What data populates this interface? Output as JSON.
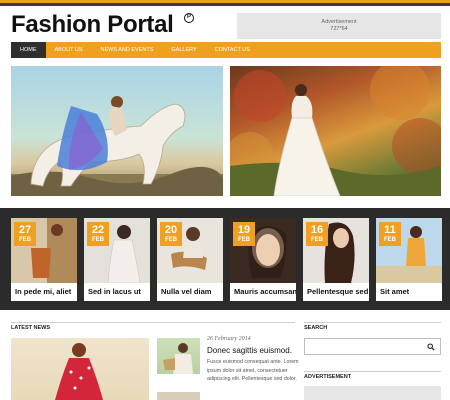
{
  "site": {
    "name": "Fashion Portal",
    "logo_mark": "P"
  },
  "ad_top": {
    "label": "Advertisement",
    "size": "727*64"
  },
  "nav": {
    "items": [
      {
        "label": "HOME"
      },
      {
        "label": "ABOUT US"
      },
      {
        "label": "NEWS AND EVENTS"
      },
      {
        "label": "GALLERY"
      },
      {
        "label": "CONTACT US"
      }
    ],
    "active": "HOME"
  },
  "featured": [
    {
      "day": "27",
      "month": "FEB",
      "title": "In pede mi, aliet"
    },
    {
      "day": "22",
      "month": "FEB",
      "title": "Sed in lacus ut"
    },
    {
      "day": "20",
      "month": "FEB",
      "title": "Nulla vel diam"
    },
    {
      "day": "19",
      "month": "FEB",
      "title": "Mauris accumsan"
    },
    {
      "day": "16",
      "month": "FEB",
      "title": "Pellentesque sed"
    },
    {
      "day": "11",
      "month": "FEB",
      "title": "Sit amet"
    }
  ],
  "latest_news": {
    "heading": "LATEST NEWS",
    "post": {
      "date": "26 February 2014",
      "title": "Donec sagittis euismod.",
      "excerpt": "Fusce euismod consequat ante. Lorem ipsum dolor sit amet, consectetuer adipiscing elit. Pellentesque sed dolor."
    }
  },
  "sidebar": {
    "search_heading": "SEARCH",
    "search_placeholder": "",
    "ad_heading": "ADVERTISEMENT"
  },
  "colors": {
    "accent": "#f0a020",
    "dark": "#2b2b2b",
    "nav_active": "#2f2f2f"
  }
}
